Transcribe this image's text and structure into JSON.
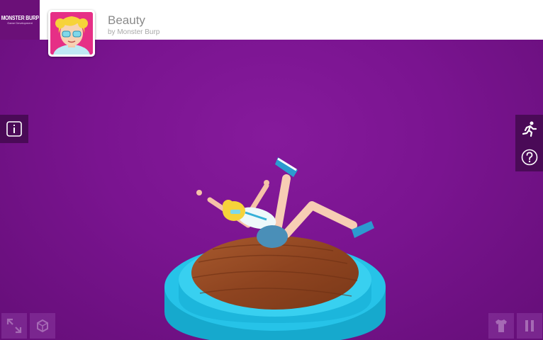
{
  "header": {
    "brand_name": "Monster Burp",
    "brand_tagline": "Game Development",
    "title": "Beauty",
    "byline": "by Monster Burp"
  },
  "colors": {
    "background": "#7a1490",
    "header": "#ffffff",
    "brand_bg": "#6b1078",
    "side_button": "#4a0a57",
    "pedestal": "#1ec8ec",
    "wood": "#9c4a22"
  },
  "controls": {
    "left": [
      {
        "icon": "info-icon"
      }
    ],
    "right": [
      {
        "icon": "running-figure-icon"
      },
      {
        "icon": "help-icon"
      }
    ],
    "bottom_left": [
      {
        "icon": "fullscreen-icon"
      },
      {
        "icon": "rotate-view-icon"
      }
    ],
    "bottom_right": [
      {
        "icon": "outfit-icon"
      },
      {
        "icon": "pause-icon"
      }
    ]
  }
}
